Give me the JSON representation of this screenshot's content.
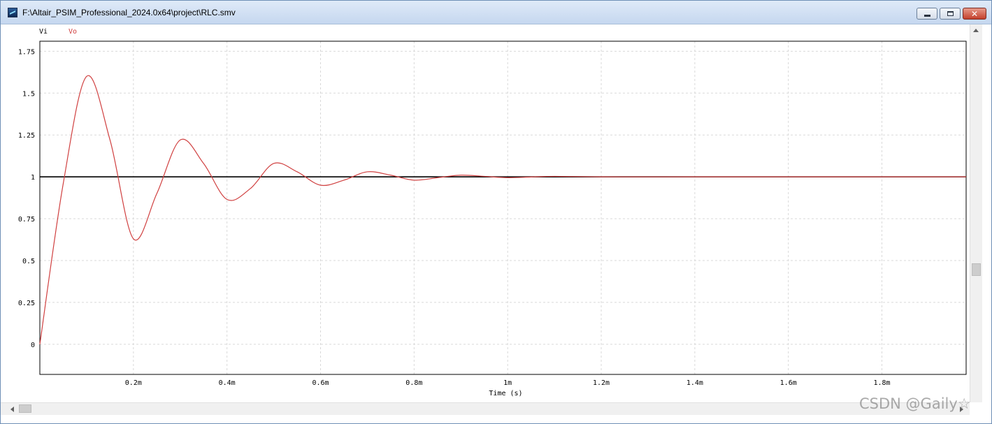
{
  "window": {
    "title": "F:\\Altair_PSIM_Professional_2024.0x64\\project\\RLC.smv"
  },
  "icons": {
    "app": "waveform-app-icon",
    "minimize": "minimize-icon",
    "maximize": "maximize-icon",
    "close": "close-icon"
  },
  "colors": {
    "vi": "#000000",
    "vo": "#d04040",
    "grid": "#d9d9d9"
  },
  "legend": {
    "vi": "Vi",
    "vo": "Vo"
  },
  "watermark": "CSDN @Gaily☆",
  "chart_data": {
    "type": "line",
    "xlabel": "Time (s)",
    "ylabel": "",
    "xlim": [
      0,
      0.00198
    ],
    "ylim": [
      -0.18,
      1.81
    ],
    "x_ticks": [
      0.0002,
      0.0004,
      0.0006,
      0.0008,
      0.001,
      0.0012,
      0.0014,
      0.0016,
      0.0018
    ],
    "x_tick_labels": [
      "0.2m",
      "0.4m",
      "0.6m",
      "0.8m",
      "1m",
      "1.2m",
      "1.4m",
      "1.6m",
      "1.8m"
    ],
    "y_ticks": [
      0,
      0.25,
      0.5,
      0.75,
      1,
      1.25,
      1.5,
      1.75
    ],
    "y_tick_labels": [
      "0",
      "0.25",
      "0.5",
      "0.75",
      "1",
      "1.25",
      "1.5",
      "1.75"
    ],
    "grid": true,
    "legend": "top-left",
    "series": [
      {
        "name": "Vi",
        "x": [
          0,
          0.00198
        ],
        "y": [
          1,
          1
        ]
      },
      {
        "name": "Vo",
        "x": [
          0,
          5e-05,
          0.0001,
          0.00015,
          0.0002,
          0.00025,
          0.0003,
          0.00035,
          0.0004,
          0.00045,
          0.0005,
          0.00055,
          0.0006,
          0.00065,
          0.0007,
          0.00075,
          0.0008,
          0.00085,
          0.0009,
          0.00095,
          0.001,
          0.00105,
          0.0011,
          0.0012,
          0.0014,
          0.0016,
          0.0018,
          0.00198
        ],
        "y": [
          0,
          0.96,
          1.6,
          1.22,
          0.63,
          0.9,
          1.22,
          1.08,
          0.865,
          0.93,
          1.08,
          1.03,
          0.95,
          0.98,
          1.03,
          1.01,
          0.98,
          0.995,
          1.01,
          1.003,
          0.995,
          0.999,
          1.003,
          1.0,
          1.0,
          1.0,
          1.0,
          1.0
        ]
      }
    ]
  }
}
